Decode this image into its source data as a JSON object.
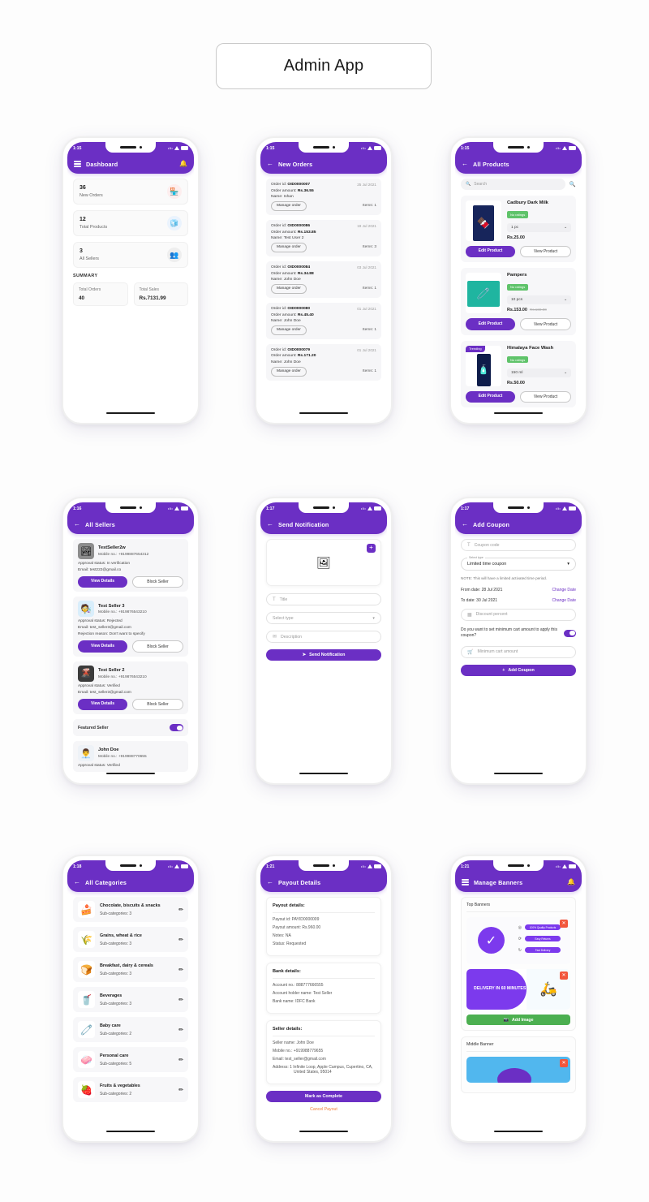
{
  "page": {
    "title": "Admin App"
  },
  "icons": {
    "hamburger": "hamburger-icon",
    "bell": "🔔",
    "back": "←",
    "search": "🔍",
    "plus": "+",
    "pencil": "✏",
    "close": "✕",
    "send": "➤",
    "camera": "📷",
    "cart": "🛒",
    "percent": "🔢",
    "title_t": "T",
    "desc": "✉",
    "image": "🖼"
  },
  "phones": {
    "dashboard": {
      "status_time": "1:15",
      "appbar_title": "Dashboard",
      "stats": [
        {
          "num": "36",
          "label": "New Orders",
          "emoji": "🏪",
          "bg": "#fdeeee"
        },
        {
          "num": "12",
          "label": "Total Products",
          "emoji": "🧊",
          "bg": "#eaf3fd"
        },
        {
          "num": "3",
          "label": "All Sellers",
          "emoji": "👥",
          "bg": "#eeeeee"
        }
      ],
      "summary_title": "SUMMARY",
      "summary": [
        {
          "label": "Total Orders",
          "value": "40"
        },
        {
          "label": "Total Sales",
          "value": "Rs.7131.99"
        }
      ]
    },
    "new_orders": {
      "status_time": "1:15",
      "appbar_title": "New Orders",
      "labels": {
        "order_id": "Order id: ",
        "order_amount": "Order amount: ",
        "name": "Name: ",
        "items": "Items: ",
        "manage": "Manage order"
      },
      "orders": [
        {
          "id": "OID0000007",
          "date": "25 Jul 2021",
          "amount": "Rs.36.55",
          "name": "Ishan",
          "items": "1"
        },
        {
          "id": "OID0000086",
          "date": "19 Jul 2021",
          "amount": "Rs.153.85",
          "name": "Test User 2",
          "items": "3"
        },
        {
          "id": "OID0000084",
          "date": "03 Jul 2021",
          "amount": "Rs.34.88",
          "name": "John Doe",
          "items": "1"
        },
        {
          "id": "OID0000080",
          "date": "01 Jul 2021",
          "amount": "Rs.45.40",
          "name": "John Doe",
          "items": "1"
        },
        {
          "id": "OID0000079",
          "date": "01 Jul 2021",
          "amount": "Rs.171.20",
          "name": "John Doe",
          "items": "1"
        }
      ]
    },
    "all_products": {
      "status_time": "1:15",
      "appbar_title": "All Products",
      "search_placeholder": "Search",
      "buttons": {
        "edit": "Edit Product",
        "view": "View Product"
      },
      "products": [
        {
          "name": "Cadbury Dark Milk",
          "rating": "No ratings",
          "variant": "1 pc",
          "price": "Rs.25.00",
          "old_price": "",
          "tag": "",
          "emoji": "🍫"
        },
        {
          "name": "Pampers",
          "rating": "No ratings",
          "variant": "10 pcs",
          "price": "Rs.153.00",
          "old_price": "Rs.180.00",
          "tag": "",
          "emoji": "🧷"
        },
        {
          "name": "Himalaya Face Wash",
          "rating": "No ratings",
          "variant": "150 ml",
          "price": "Rs.50.00",
          "old_price": "",
          "tag": "Trending",
          "emoji": "🧴"
        }
      ]
    },
    "all_sellers": {
      "status_time": "1:16",
      "appbar_title": "All Sellers",
      "labels": {
        "mobile": "Mobile no.: ",
        "approval": "Approval status: ",
        "email": "Email: ",
        "rejection": "Rejection reason: ",
        "view": "View Details",
        "block": "Block Seller",
        "featured": "Featured Seller"
      },
      "sellers": [
        {
          "name": "TestSeller2w",
          "mobile": "+9199887654312",
          "approval": "In verification",
          "email": "test222@gmail.co",
          "rejection": "",
          "emoji": "🏞"
        },
        {
          "name": "Test Seller 3",
          "mobile": "+919876543210",
          "approval": "Rejected",
          "email": "test_seller3@gmail.com",
          "rejection": "Don't want to specify",
          "emoji": "🧑‍🔬"
        },
        {
          "name": "Test Seller 2",
          "mobile": "+919876543210",
          "approval": "Verified",
          "email": "test_seller3@gmail.com",
          "rejection": "",
          "emoji": "🌋"
        },
        {
          "name": "John Doe",
          "mobile": "+919988770655",
          "approval": "Verified",
          "email": "",
          "rejection": "",
          "emoji": "👨‍💼"
        }
      ]
    },
    "send_notification": {
      "status_time": "1:17",
      "appbar_title": "Send Notification",
      "title_placeholder": "Title",
      "select_type": "Select type",
      "description_placeholder": "Description",
      "submit_label": "Send Notification"
    },
    "add_coupon": {
      "status_time": "1:17",
      "appbar_title": "Add Coupon",
      "coupon_code_placeholder": "Coupon code",
      "select_label": "Select type",
      "select_value": "Limited time coupon",
      "note": "NOTE: This will have a limited activated time period.",
      "from_date": "From date: 28 Jul 2021",
      "to_date": "To date: 30 Jul 2021",
      "change_date": "Change Date",
      "discount_placeholder": "Discount percent",
      "min_cart_question": "Do you want to set minimum cart amount to apply this coupon?",
      "min_cart_placeholder": "Minimum cart amount",
      "submit_label": "Add Coupon"
    },
    "all_categories": {
      "status_time": "1:18",
      "appbar_title": "All Categories",
      "sub_label": "Sub-categories: ",
      "categories": [
        {
          "name": "Chocolate, biscuits & snacks",
          "count": "3",
          "emoji": "🍰"
        },
        {
          "name": "Grains, wheat & rice",
          "count": "3",
          "emoji": "🌾"
        },
        {
          "name": "Breakfast, dairy & cereals",
          "count": "3",
          "emoji": "🍞"
        },
        {
          "name": "Beverages",
          "count": "3",
          "emoji": "🥤"
        },
        {
          "name": "Baby care",
          "count": "2",
          "emoji": "🧷"
        },
        {
          "name": "Personal care",
          "count": "5",
          "emoji": "🧼"
        },
        {
          "name": "Fruits & vegetables",
          "count": "2",
          "emoji": "🍓"
        }
      ]
    },
    "payout_details": {
      "status_time": "1:21",
      "appbar_title": "Payout Details",
      "payout_title": "Payout details:",
      "payout_lines": [
        "Payout id: PAYID0000009",
        "Payout amount: Rs.960.00",
        "Notes: NA",
        "Status: Requested"
      ],
      "bank_title": "Bank details:",
      "bank_lines": [
        "Account no.: 888777666555",
        "Account holder name: Test Seller",
        "Bank name: IDFC Bank"
      ],
      "seller_title": "Seller details:",
      "seller_lines": [
        "Seller name: John Doe",
        "Mobile no.: +919988779655",
        "Email: test_seller@gmail.com"
      ],
      "seller_address": "Address: 1 Infinite Loop, Apple Campus, Cupertino, CA, United States, 95014",
      "complete_label": "Mark as Complete",
      "cancel_label": "Cancel Payout"
    },
    "manage_banners": {
      "status_time": "1:21",
      "appbar_title": "Manage Banners",
      "top_banner_title": "Top Banners",
      "middle_banner_title": "Middle Banner",
      "add_image_label": "Add Image",
      "banner1_pills": [
        "100% Quality Products",
        "Easy Returns",
        "Fast Delivery"
      ],
      "banner2_text": "DELIVERY IN 60 MINUTES"
    }
  },
  "colors": {
    "purple": "#6b2fc4",
    "green": "#4caf50",
    "red": "#f2563c",
    "orange": "#f0803c",
    "blue": "#51b7ee"
  }
}
